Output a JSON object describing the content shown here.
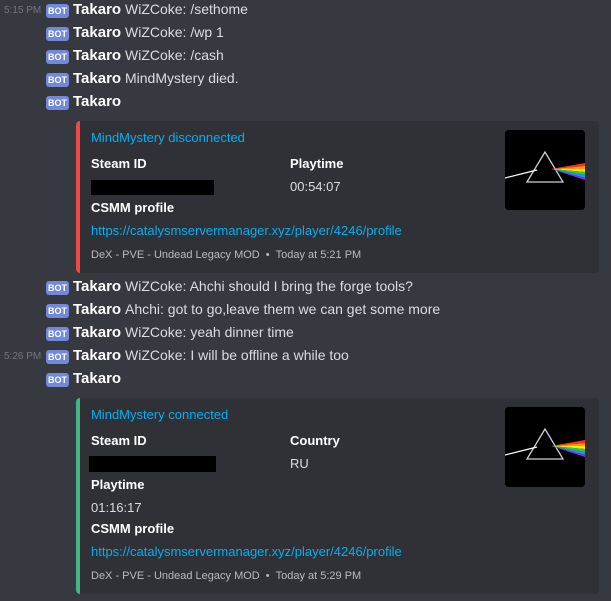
{
  "bot_badge": "BOT",
  "author": "Takaro",
  "messages_top": [
    {
      "time": "5:15 PM",
      "text": "WiZCoke: /sethome"
    },
    {
      "time": "",
      "text": "WiZCoke: /wp 1"
    },
    {
      "time": "",
      "text": "WiZCoke: /cash"
    },
    {
      "time": "",
      "text": "MindMystery died."
    },
    {
      "time": "",
      "text": ""
    }
  ],
  "embed1": {
    "title": "MindMystery disconnected",
    "field_steam": "Steam ID",
    "field_playtime": "Playtime",
    "playtime_value": "00:54:07",
    "field_csmm": "CSMM profile",
    "link": "https://catalysmservermanager.xyz/player/4246/profile",
    "footer_server": "DeX - PVE - Undead Legacy MOD",
    "footer_time": "Today at 5:21 PM",
    "accent": "#f04747"
  },
  "messages_mid": [
    {
      "time": "",
      "text": "WiZCoke: Ahchi should I bring the forge tools?"
    },
    {
      "time": "",
      "text": "Ahchi: got to go,leave them we can get some more"
    },
    {
      "time": "",
      "text": "WiZCoke: yeah dinner time"
    },
    {
      "time": "5:26 PM",
      "text": "WiZCoke: I will be offline a while too"
    },
    {
      "time": "",
      "text": ""
    }
  ],
  "embed2": {
    "title": "MindMystery connected",
    "field_steam": "Steam ID",
    "field_country": "Country",
    "country_value": "RU",
    "field_playtime": "Playtime",
    "playtime_value": "01:16:17",
    "field_csmm": "CSMM profile",
    "link": "https://catalysmservermanager.xyz/player/4246/profile",
    "footer_server": "DeX - PVE - Undead Legacy MOD",
    "footer_time": "Today at 5:29 PM",
    "accent": "#43b581"
  },
  "thumbnail_icon": "prism-album-art-icon"
}
